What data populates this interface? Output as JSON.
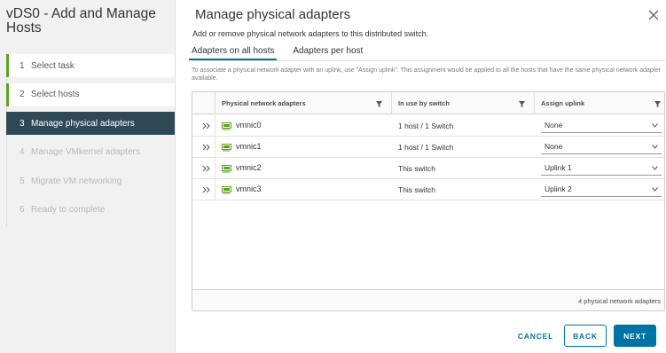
{
  "wizard": {
    "title": "vDS0 - Add and Manage Hosts",
    "steps": [
      {
        "num": "1",
        "label": "Select task",
        "state": "done"
      },
      {
        "num": "2",
        "label": "Select hosts",
        "state": "done"
      },
      {
        "num": "3",
        "label": "Manage physical adapters",
        "state": "active"
      },
      {
        "num": "4",
        "label": "Manage VMkernel adapters",
        "state": "disabled"
      },
      {
        "num": "5",
        "label": "Migrate VM networking",
        "state": "disabled"
      },
      {
        "num": "6",
        "label": "Ready to complete",
        "state": "disabled"
      }
    ]
  },
  "page": {
    "title": "Manage physical adapters",
    "subtitle": "Add or remove physical network adapters to this distributed switch.",
    "close_icon": "close-icon"
  },
  "tabs": [
    {
      "label": "Adapters on all hosts",
      "active": true
    },
    {
      "label": "Adapters per host",
      "active": false
    }
  ],
  "info_text": "To associate a physical network adapter with an uplink, use \"Assign uplink\". This assignment would be applied to all the hosts that have the same physical network adapter available.",
  "grid": {
    "columns": [
      "Physical network adapters",
      "In use by switch",
      "Assign uplink"
    ],
    "rows": [
      {
        "name": "vmnic0",
        "in_use": "1 host / 1 Switch",
        "uplink": "None"
      },
      {
        "name": "vmnic1",
        "in_use": "1 host / 1 Switch",
        "uplink": "None"
      },
      {
        "name": "vmnic2",
        "in_use": "This switch",
        "uplink": "Uplink 1"
      },
      {
        "name": "vmnic3",
        "in_use": "This switch",
        "uplink": "Uplink 2"
      }
    ],
    "footer": "4 physical network adapters"
  },
  "buttons": {
    "cancel": "CANCEL",
    "back": "BACK",
    "next": "NEXT"
  },
  "colors": {
    "accent": "#0072a3",
    "step_done": "#5aa220",
    "step_active": "#2f4858",
    "nic_icon": "#5aa220"
  }
}
